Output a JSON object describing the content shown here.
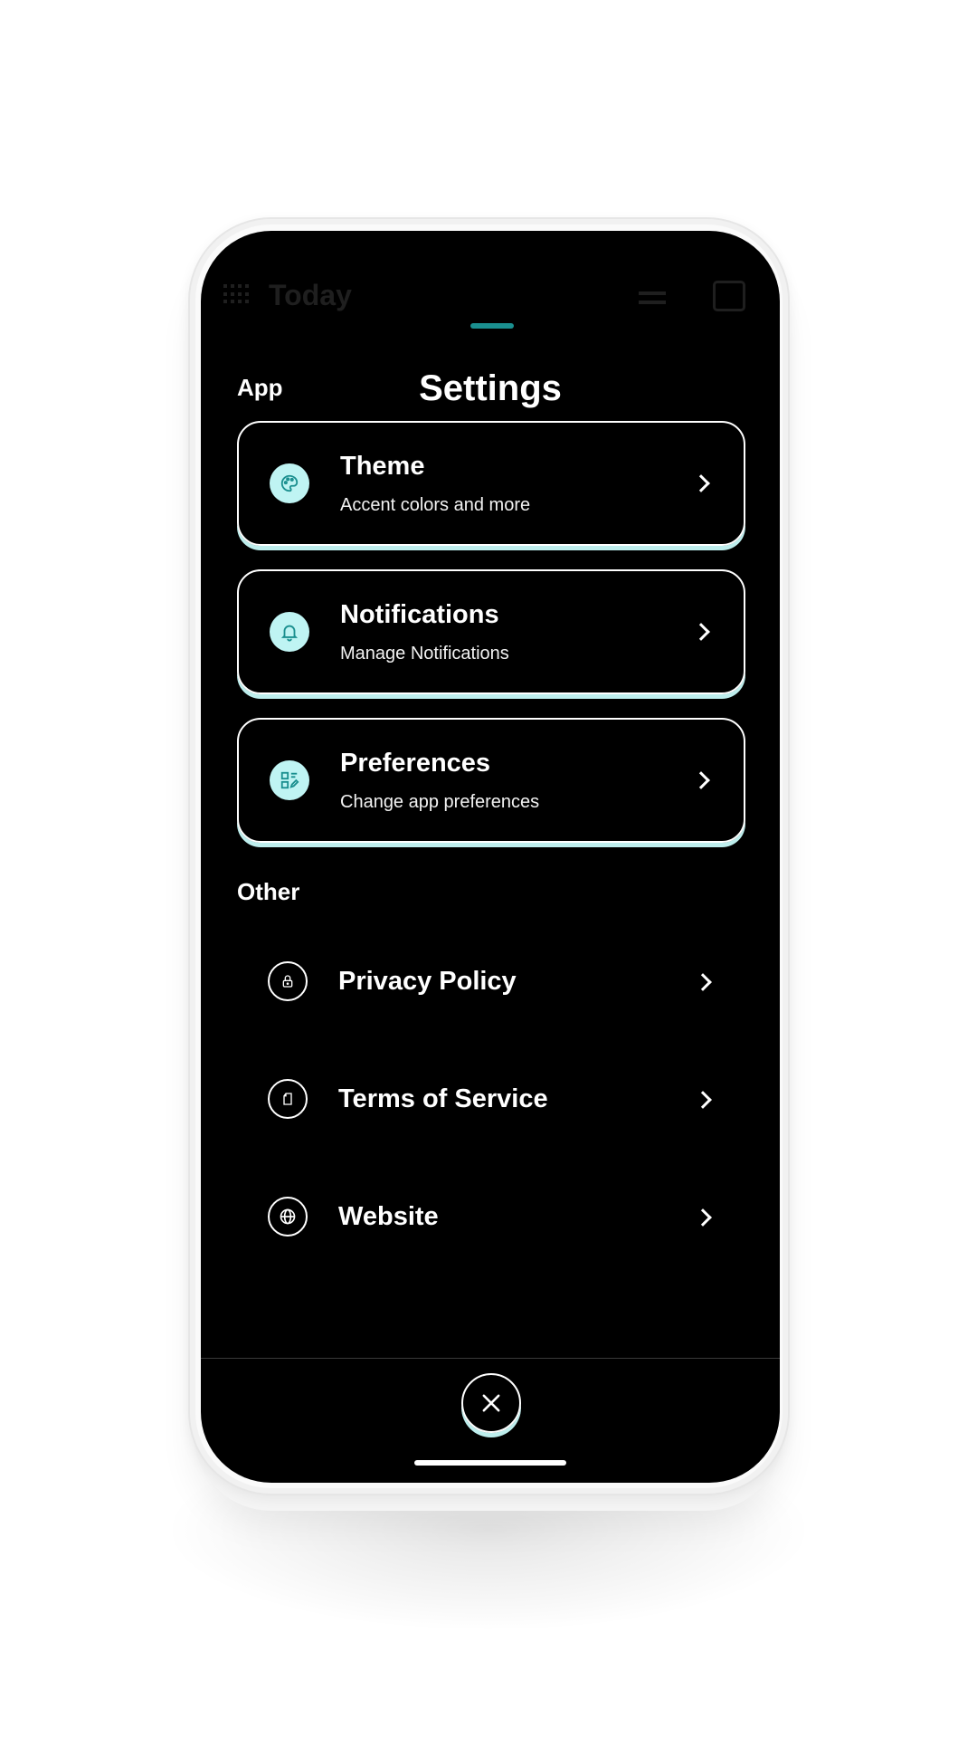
{
  "background_header": {
    "title": "Today"
  },
  "sheet": {
    "title": "Settings",
    "sections": {
      "app": {
        "label": "App",
        "items": [
          {
            "title": "Theme",
            "subtitle": "Accent colors and more",
            "icon": "palette-icon"
          },
          {
            "title": "Notifications",
            "subtitle": "Manage Notifications",
            "icon": "bell-icon"
          },
          {
            "title": "Preferences",
            "subtitle": "Change app preferences",
            "icon": "preferences-icon"
          }
        ]
      },
      "other": {
        "label": "Other",
        "items": [
          {
            "title": "Privacy Policy",
            "icon": "lock-icon"
          },
          {
            "title": "Terms of Service",
            "icon": "document-icon"
          },
          {
            "title": "Website",
            "icon": "globe-icon"
          }
        ]
      }
    },
    "close_icon": "close-icon"
  },
  "colors": {
    "accent": "#bff4f3",
    "accent_shadow": "#bdeeed",
    "handle": "#1a8f8f",
    "icon_dark": "#1a8f8f",
    "screen_bg": "#000000"
  }
}
